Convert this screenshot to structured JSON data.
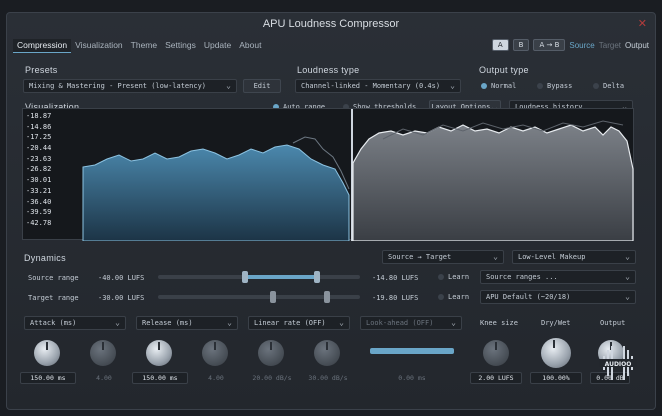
{
  "window": {
    "title": "APU Loudness Compressor",
    "close_icon": "close-icon"
  },
  "tabs": [
    "Compression",
    "Visualization",
    "Theme",
    "Settings",
    "Update",
    "About"
  ],
  "ab": {
    "a": "A",
    "b": "B",
    "ab": "A → B",
    "source": "Source",
    "target": "Target",
    "output": "Output"
  },
  "presets": {
    "header": "Presets",
    "value": "Mixing & Mastering - Present (low-latency)",
    "edit": "Edit"
  },
  "loudness_type": {
    "header": "Loudness type",
    "value": "Channel-linked - Momentary (0.4s)"
  },
  "output_type": {
    "header": "Output type",
    "options": [
      "Normal",
      "Bypass",
      "Delta"
    ],
    "selected": "Normal"
  },
  "visualization": {
    "header": "Visualization",
    "auto_range": "Auto range",
    "show_thresholds": "Show thresholds",
    "layout_options": "Layout Options..",
    "mode": "Loudness history",
    "y_labels": [
      "-18.87",
      "-14.86",
      "-17.25",
      "-20.44",
      "-23.63",
      "-26.82",
      "-30.01",
      "-33.21",
      "-36.40",
      "-39.59",
      "-42.78"
    ]
  },
  "dynamics": {
    "header": "Dynamics",
    "routing": "Source → Target",
    "mode": "Low-Level Makeup",
    "source_range": {
      "label": "Source range",
      "low": "-40.00 LUFS",
      "high": "-14.80 LUFS",
      "learn": "Learn",
      "preset": "Source ranges ..."
    },
    "target_range": {
      "label": "Target range",
      "low": "-30.00 LUFS",
      "high": "-19.80 LUFS",
      "learn": "Learn",
      "preset": "APU Default (~20/18)"
    }
  },
  "controls": [
    {
      "label": "Attack (ms)",
      "value": "150.00 ms",
      "active": true
    },
    {
      "label": "",
      "value": "4.00",
      "active": false
    },
    {
      "label": "Release (ms)",
      "value": "150.00 ms",
      "active": true
    },
    {
      "label": "",
      "value": "4.00",
      "active": false
    },
    {
      "label": "Linear rate (OFF)",
      "value": "20.00 dB/s",
      "active": false
    },
    {
      "label": "",
      "value": "30.00 dB/s",
      "active": false
    },
    {
      "label": "Look-ahead (OFF)",
      "value": "0.00 ms",
      "active": false
    },
    {
      "label": "Knee size",
      "value": "2.00 LUFS",
      "active": true
    },
    {
      "label": "Dry/Wet",
      "value": "100.00%",
      "active": true
    },
    {
      "label": "Output",
      "value": "0.00 dB",
      "active": true
    }
  ],
  "logo_text": "AUDIOO",
  "colors": {
    "accent": "#6aa6c8",
    "background": "#23272d",
    "panel": "#15181c"
  }
}
